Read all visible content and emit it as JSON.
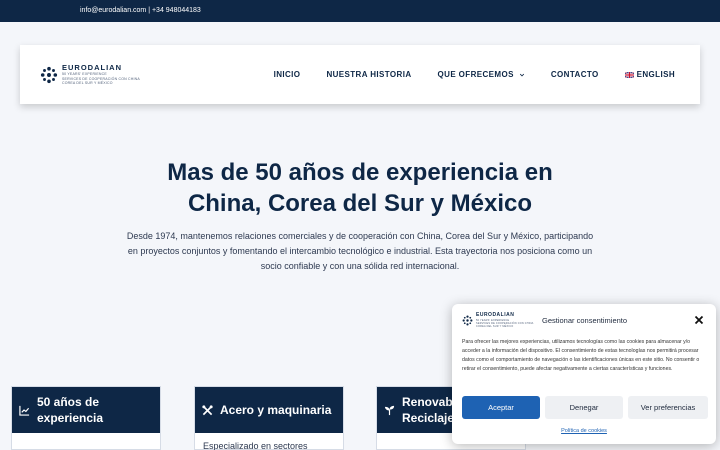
{
  "topbar": {
    "contact": "info@eurodalian.com | +34 948044183"
  },
  "logo": {
    "name": "EURODALIAN",
    "sub1": "50 YEARS' EXPERIENCE",
    "sub2": "SERVICES DE COOPERACIÓN CON CHINA",
    "sub3": "COREA DEL SUR Y MÉXICO"
  },
  "nav": {
    "items": [
      {
        "label": "INICIO"
      },
      {
        "label": "NUESTRA HISTORIA"
      },
      {
        "label": "QUE OFRECEMOS"
      },
      {
        "label": "CONTACTO"
      },
      {
        "label": "ENGLISH"
      }
    ]
  },
  "hero": {
    "title_line1": "Mas de 50 años de experiencia en",
    "title_line2": "China, Corea del Sur y México",
    "text": "Desde 1974, mantenemos relaciones comerciales y de cooperación con China, Corea del Sur y México, participando en proyectos conjuntos y fomentando el intercambio tecnológico e industrial. Esta trayectoria nos posiciona como un socio confiable y con una sólida red internacional."
  },
  "cards": [
    {
      "title": "50 años de experiencia",
      "body": ""
    },
    {
      "title": "Acero y maquinaria",
      "body": "Especializado en sectores"
    },
    {
      "title": "Renovables y Reciclaje",
      "body": ""
    }
  ],
  "consent": {
    "title": "Gestionar consentimiento",
    "text": "Para ofrecer las mejores experiencias, utilizamos tecnologías como las cookies para almacenar y/o acceder a la información del dispositivo. El consentimiento de estas tecnologías nos permitirá procesar datos como el comportamiento de navegación o las identificaciones únicas en este sitio. No consentir o retirar el consentimiento, puede afectar negativamente a ciertas características y funciones.",
    "accept": "Aceptar",
    "deny": "Denegar",
    "prefs": "Ver preferencias",
    "policy": "Política de cookies"
  },
  "colors": {
    "navy": "#0e2746",
    "accent": "#1e62b3"
  }
}
